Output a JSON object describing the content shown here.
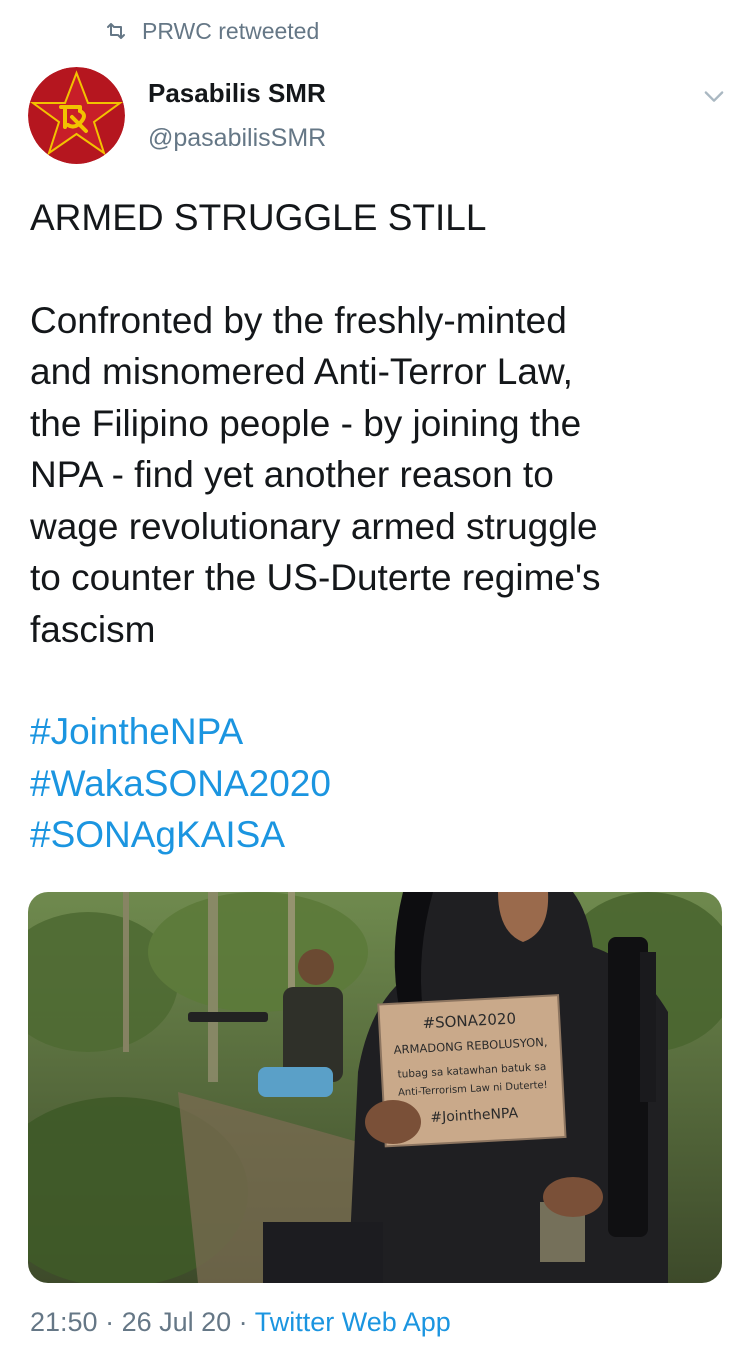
{
  "retweet": {
    "label": "PRWC retweeted"
  },
  "author": {
    "name": "Pasabilis SMR",
    "handle": "@pasabilisSMR"
  },
  "tweet": {
    "headline": "ARMED STRUGGLE STILL",
    "body": "Confronted by the freshly-minted\nand misnomered Anti-Terror Law,\nthe Filipino people - by joining the\nNPA - find yet another reason to\nwage revolutionary armed struggle\nto counter the US-Duterte regime's\nfascism",
    "hashtags": [
      "#JointheNPA",
      "#WakaSONA2020",
      "#SONAgKAISA"
    ]
  },
  "media": {
    "sign": {
      "line1": "#SONA2020",
      "line2": "ARMADONG REBOLUSYON,",
      "line3": "tubag sa katawhan batuk sa",
      "line4": "Anti-Terrorism Law ni Duterte!",
      "line5": "#JointheNPA"
    }
  },
  "meta": {
    "time": "21:50",
    "date": "26 Jul 20",
    "app": "Twitter Web App",
    "separator": " · "
  },
  "colors": {
    "link": "#1b95e0",
    "muted": "#657786",
    "text": "#14171a",
    "avatar_red": "#b5161f",
    "avatar_gold": "#f2c200"
  }
}
